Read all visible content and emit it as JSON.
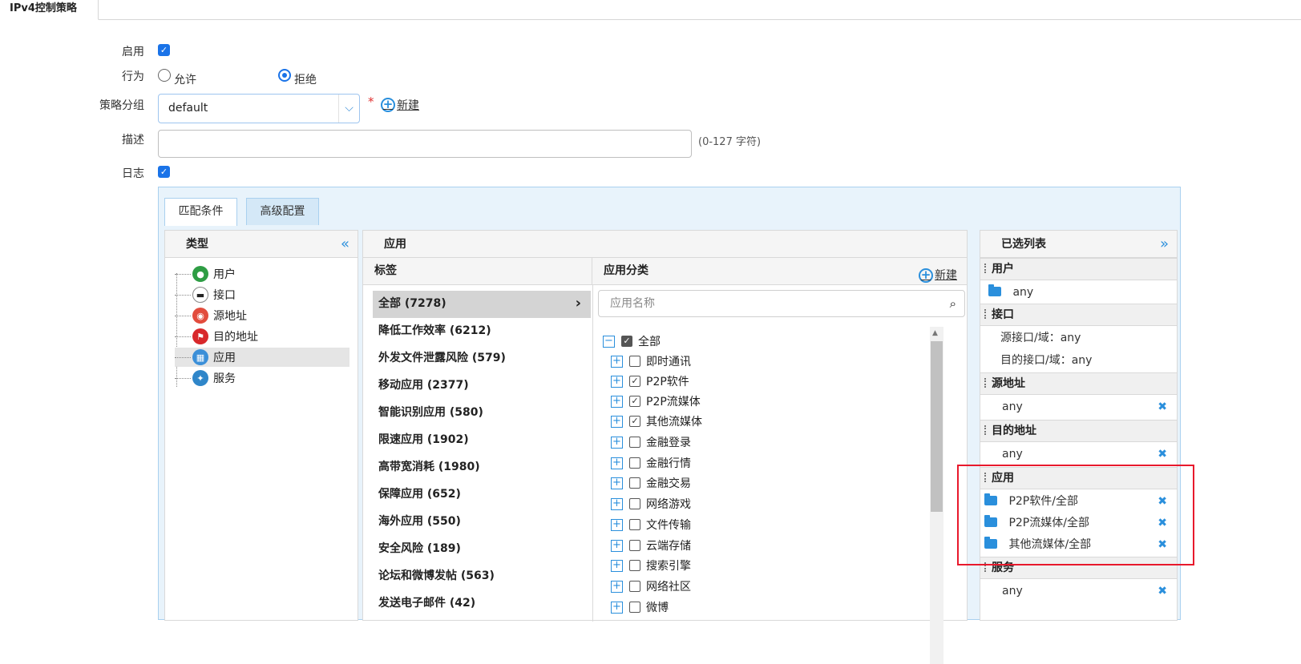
{
  "page": {
    "tab_title": "IPv4控制策略"
  },
  "form": {
    "enable_label": "启用",
    "action_label": "行为",
    "action_options": [
      "允许",
      "拒绝"
    ],
    "group_label": "策略分组",
    "group_value": "default",
    "required_mark": "*",
    "new_link": "新建",
    "desc_label": "描述",
    "desc_value": "",
    "desc_hint": "(0-127 字符)",
    "log_label": "日志"
  },
  "panel": {
    "tabs": [
      "匹配条件",
      "高级配置"
    ],
    "type_col": {
      "title": "类型",
      "collapse_icon": "«",
      "items": [
        "用户",
        "接口",
        "源地址",
        "目的地址",
        "应用",
        "服务"
      ],
      "selected": "应用"
    },
    "app_col": {
      "title": "应用",
      "labels_header": "标签",
      "labels": [
        "全部 (7278)",
        "降低工作效率 (6212)",
        "外发文件泄露风险 (579)",
        "移动应用 (2377)",
        "智能识别应用 (580)",
        "限速应用 (1902)",
        "高带宽消耗 (1980)",
        "保障应用 (652)",
        "海外应用 (550)",
        "安全风险 (189)",
        "论坛和微博发帖 (563)",
        "发送电子邮件 (42)"
      ],
      "category_header": "应用分类",
      "category_new": "新建",
      "search_placeholder": "应用名称",
      "tree_root": "全部",
      "categories": [
        {
          "name": "即时通讯",
          "checked": false
        },
        {
          "name": "P2P软件",
          "checked": true
        },
        {
          "name": "P2P流媒体",
          "checked": true
        },
        {
          "name": "其他流媒体",
          "checked": true
        },
        {
          "name": "金融登录",
          "checked": false
        },
        {
          "name": "金融行情",
          "checked": false
        },
        {
          "name": "金融交易",
          "checked": false
        },
        {
          "name": "网络游戏",
          "checked": false
        },
        {
          "name": "文件传输",
          "checked": false
        },
        {
          "name": "云端存储",
          "checked": false
        },
        {
          "name": "搜索引擎",
          "checked": false
        },
        {
          "name": "网络社区",
          "checked": false
        },
        {
          "name": "微博",
          "checked": false
        }
      ]
    },
    "selected_col": {
      "title": "已选列表",
      "expand_icon": "»",
      "sections": {
        "user": {
          "title": "用户",
          "value": "any"
        },
        "iface": {
          "title": "接口",
          "src": "源接口/域：any",
          "dst": "目的接口/域：any"
        },
        "src": {
          "title": "源地址",
          "value": "any"
        },
        "dst": {
          "title": "目的地址",
          "value": "any"
        },
        "app": {
          "title": "应用",
          "values": [
            "P2P软件/全部",
            "P2P流媒体/全部",
            "其他流媒体/全部"
          ]
        },
        "svc": {
          "title": "服务",
          "value": "any"
        }
      }
    }
  },
  "colors": {
    "accent": "#2a8fdc",
    "checkbox": "#1a73e8",
    "highlight_border": "#e8192c"
  }
}
